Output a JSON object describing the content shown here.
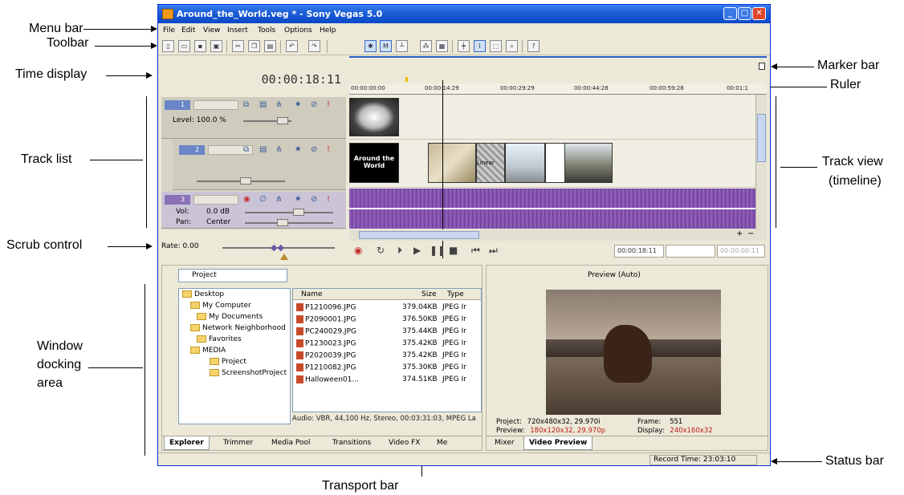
{
  "window": {
    "title": "Around_the_World.veg * - Sony Vegas 5.0",
    "controls": {
      "minimize": "_",
      "maximize": "□",
      "close": "✕"
    }
  },
  "menu": [
    "File",
    "Edit",
    "View",
    "Insert",
    "Tools",
    "Options",
    "Help"
  ],
  "time_display": "00:00:18:11",
  "ruler": [
    "00:00:00:00",
    "00:00:14:29",
    "00:00:29:29",
    "00:00:44:28",
    "00:00:59:28",
    "00:01:1"
  ],
  "tracks": {
    "t1": {
      "number": "1",
      "level": "Level: 100.0 %"
    },
    "t2": {
      "number": "2"
    },
    "t3": {
      "number": "3",
      "vol_label": "Vol:",
      "vol_value": "0.0 dB",
      "pan_label": "Pan:",
      "pan_value": "Center"
    }
  },
  "clips": {
    "title_clip": "Around the World",
    "transition": "Linear"
  },
  "scrub": {
    "rate": "Rate: 0.00"
  },
  "transport": {
    "timecode": "00:00:18:11",
    "tc2": "",
    "tc3": "00:00:00:11"
  },
  "explorer": {
    "location": "Project",
    "tree": [
      "Desktop",
      "My Computer",
      "My Documents",
      "Network Neighborhood",
      "Favorites",
      "MEDIA",
      "Project",
      "ScreenshotProject"
    ],
    "columns": {
      "name": "Name",
      "size": "Size",
      "type": "Type"
    },
    "files": [
      {
        "name": "P1210096.JPG",
        "size": "379.04KB",
        "type": "JPEG Ir"
      },
      {
        "name": "P2090001.JPG",
        "size": "376.50KB",
        "type": "JPEG Ir"
      },
      {
        "name": "PC240029.JPG",
        "size": "375.44KB",
        "type": "JPEG Ir"
      },
      {
        "name": "P1230023.JPG",
        "size": "375.42KB",
        "type": "JPEG Ir"
      },
      {
        "name": "P2020039.JPG",
        "size": "375.42KB",
        "type": "JPEG Ir"
      },
      {
        "name": "P1210082.JPG",
        "size": "375.30KB",
        "type": "JPEG Ir"
      },
      {
        "name": "Halloween01...",
        "size": "374.51KB",
        "type": "JPEG Ir"
      }
    ],
    "status": "Audio: VBR, 44,100 Hz, Stereo, 00:03:31:03, MPEG La",
    "tabs": [
      "Explorer",
      "Trimmer",
      "Media Pool",
      "Transitions",
      "Video FX",
      "Me"
    ]
  },
  "preview": {
    "mode": "Preview (Auto)",
    "project_label": "Project:",
    "project_value": "720x480x32, 29.970i",
    "preview_label": "Preview:",
    "preview_value": "180x120x32, 29.970p",
    "frame_label": "Frame:",
    "frame_value": "551",
    "display_label": "Display:",
    "display_value": "240x160x32",
    "tabs": [
      "Mixer",
      "Video Preview"
    ]
  },
  "status_bar": {
    "record_time": "Record Time: 23:03:10"
  },
  "callouts": {
    "menu_bar": "Menu bar",
    "toolbar": "Toolbar",
    "time_display": "Time display",
    "track_list": "Track list",
    "scrub_control": "Scrub control",
    "window_docking_1": "Window",
    "window_docking_2": "docking",
    "window_docking_3": "area",
    "marker_bar": "Marker bar",
    "ruler": "Ruler",
    "track_view_1": "Track view",
    "track_view_2": "(timeline)",
    "status_bar": "Status bar",
    "transport_bar": "Transport bar"
  },
  "colors": {
    "title_bar": "#0a48c8",
    "audio_track": "#7f4fa8",
    "accent_red": "#c01818"
  },
  "icons": [
    "app-icon",
    "new-icon",
    "open-icon",
    "save-icon",
    "cut-icon",
    "copy-icon",
    "paste-icon",
    "undo-icon",
    "record-icon",
    "play-icon",
    "pause-icon",
    "stop-icon",
    "folder-icon"
  ]
}
